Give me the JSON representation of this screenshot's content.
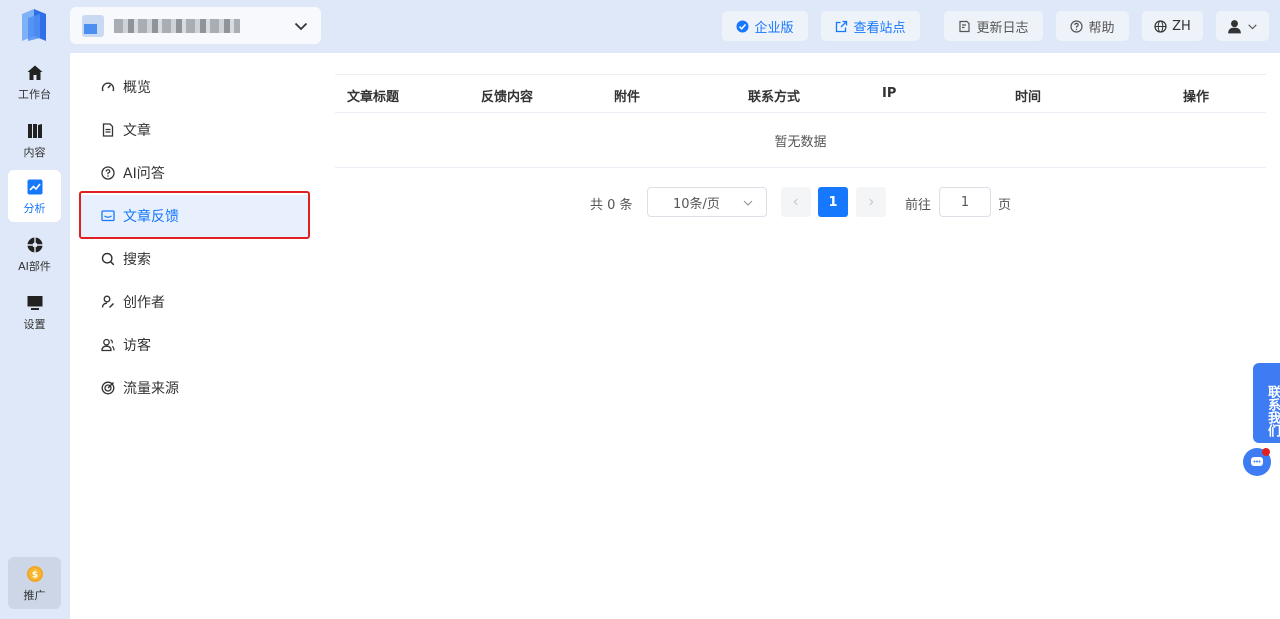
{
  "rail": {
    "items": [
      {
        "label": "工作台",
        "icon": "home-icon"
      },
      {
        "label": "内容",
        "icon": "content-icon"
      },
      {
        "label": "分析",
        "icon": "chart-icon",
        "active": true
      },
      {
        "label": "AI部件",
        "icon": "ai-widget-icon"
      },
      {
        "label": "设置",
        "icon": "monitor-icon"
      }
    ],
    "promo_label": "推广"
  },
  "header": {
    "site_name": "███████████",
    "buttons": {
      "enterprise": "企业版",
      "view_site": "查看站点",
      "changelog": "更新日志",
      "help": "帮助",
      "lang": "ZH"
    }
  },
  "subnav": {
    "items": [
      {
        "label": "概览",
        "icon": "overview-icon"
      },
      {
        "label": "文章",
        "icon": "article-icon"
      },
      {
        "label": "AI问答",
        "icon": "ai-qa-icon"
      },
      {
        "label": "文章反馈",
        "icon": "feedback-icon",
        "active": true
      },
      {
        "label": "搜索",
        "icon": "search-icon"
      },
      {
        "label": "创作者",
        "icon": "creator-icon"
      },
      {
        "label": "访客",
        "icon": "visitor-icon"
      },
      {
        "label": "流量来源",
        "icon": "traffic-icon"
      }
    ]
  },
  "table": {
    "columns": [
      "文章标题",
      "反馈内容",
      "附件",
      "联系方式",
      "IP",
      "时间",
      "操作"
    ],
    "empty_text": "暂无数据"
  },
  "pager": {
    "total_text": "共 0 条",
    "page_size": "10条/页",
    "current_page": "1",
    "goto_label": "前往",
    "goto_value": "1",
    "page_suffix": "页"
  },
  "contact": {
    "label": "联系我们"
  },
  "colors": {
    "accent": "#1677ff",
    "background": "#dfe8f8",
    "highlight": "#e02020"
  }
}
